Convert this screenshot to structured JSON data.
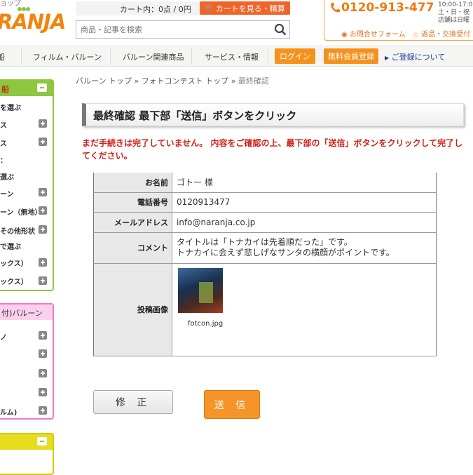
{
  "header": {
    "logo_top": "ョップ",
    "logo": "RANJA",
    "cart_status": "カート内：0点 / 0円",
    "cart_button": "カートを見る・精算",
    "search_placeholder": "商品・記事を検索",
    "phone": "0120-913-477",
    "hours_line1": "10:00-17:0",
    "hours_line2": "土・日・祝",
    "hours_line3": "店舗は日曜",
    "contact_link": "お問合せフォーム",
    "return_link": "返品・交換受付"
  },
  "nav": {
    "items": [
      "船",
      "フィルム・バルーン",
      "バルーン関連商品",
      "サービス・情報"
    ],
    "login": "ログイン",
    "free_register": "無料会員登録",
    "register_about": "ご登録について"
  },
  "sidebar": {
    "panel1_head": "船",
    "panel1_items": [
      "を選ぶ",
      "ス",
      "ス",
      "：",
      "選ぶ",
      "ーン",
      "ーン（無地）",
      "その他形状",
      "で選ぶ",
      "ックス）",
      "ックス）"
    ],
    "panel2_head": "付)バルーン",
    "panel2_items": [
      "",
      "",
      "",
      "",
      "ルム)"
    ]
  },
  "breadcrumb": {
    "items": [
      "バルーン トップ",
      "フォトコンテスト トップ"
    ],
    "current": "最終確認",
    "separator": "»"
  },
  "main": {
    "title": "最終確認 最下部「送信」ボタンをクリック",
    "notice": "まだ手続きは完了していません。 内容をご確認の上、最下部の「送信」ボタンをクリックして完了してください。",
    "rows": {
      "name_label": "お名前",
      "name_value": "ゴトー 様",
      "phone_label": "電話番号",
      "phone_value": "0120913477",
      "email_label": "メールアドレス",
      "email_value": "info@naranja.co.jp",
      "comment_label": "コメント",
      "comment_line1": "タイトルは「トナカイは先着順だった」です。",
      "comment_line2": "トナカイに会えず悲しげなサンタの横顔がポイントです。",
      "image_label": "投稿画像",
      "image_filename": "fotcon.jpg"
    },
    "fix_button": "修 正",
    "send_button": "送 信"
  },
  "colors": {
    "accent": "#f5921e",
    "brand_green": "#8dc63f",
    "alert": "#d0201a"
  }
}
